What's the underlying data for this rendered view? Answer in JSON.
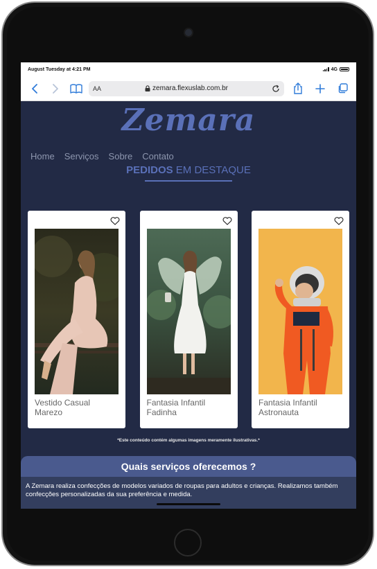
{
  "statusbar": {
    "datetime": "August Tuesday at 4:21 PM",
    "network": "4G"
  },
  "browser": {
    "text_size": "AA",
    "url": "zemara.flexuslab.com.br"
  },
  "site": {
    "logo": "Zemara",
    "nav": [
      "Home",
      "Serviços",
      "Sobre",
      "Contato"
    ],
    "section_title_bold": "PEDIDOS",
    "section_title_rest": " EM DESTAQUE",
    "cards": [
      {
        "title": "Vestido Casual Marezo"
      },
      {
        "title": "Fantasia Infantil Fadinha"
      },
      {
        "title": "Fantasia Infantil Astronauta"
      }
    ],
    "disclaimer": "*Este conteúdo contém algumas imagens meramente ilustrativas.*",
    "services_title": "Quais serviços oferecemos ?",
    "services_text": "A Zemara realiza confecções de modelos variados de roupas para adultos e crianças. Realizamos também confecções personalizadas da sua preferência e medida."
  },
  "colors": {
    "accent": "#5a70b8",
    "background": "#222a45",
    "browser_blue": "#2f7bd9"
  }
}
